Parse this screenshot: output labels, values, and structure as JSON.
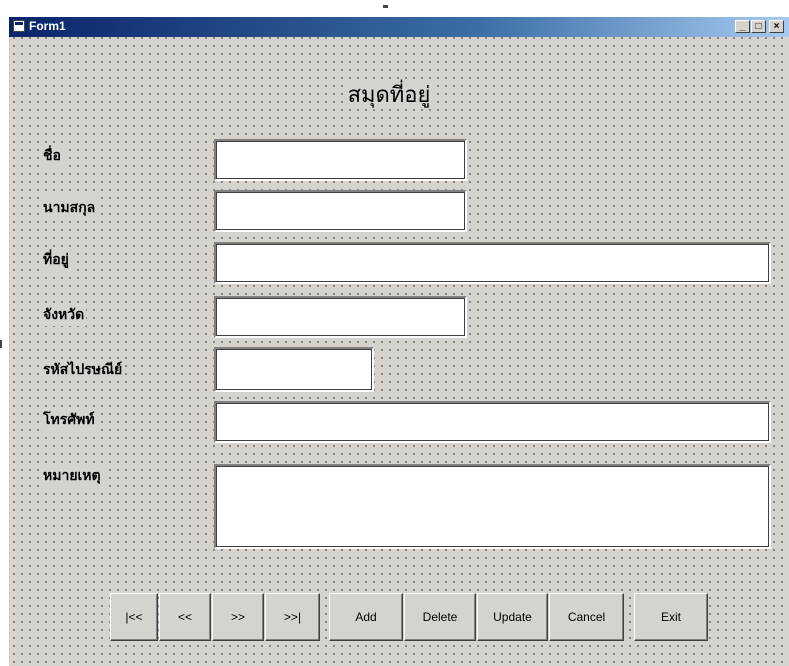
{
  "window": {
    "title": "Form1",
    "controls": {
      "minimize": "_",
      "maximize": "□",
      "close": "×"
    }
  },
  "form": {
    "heading": "สมุดที่อยู่",
    "fields": [
      {
        "label": "ชื่อ",
        "value": ""
      },
      {
        "label": "นามสกุล",
        "value": ""
      },
      {
        "label": "ที่อยู่",
        "value": ""
      },
      {
        "label": "จังหวัด",
        "value": ""
      },
      {
        "label": "รหัสไปรษณีย์",
        "value": ""
      },
      {
        "label": "โทรศัพท์",
        "value": ""
      },
      {
        "label": "หมายเหตุ",
        "value": ""
      }
    ]
  },
  "buttons": {
    "first": "|<<",
    "prev": "<<",
    "next": ">>",
    "last": ">>|",
    "add": "Add",
    "delete": "Delete",
    "update": "Update",
    "cancel": "Cancel",
    "exit": "Exit"
  },
  "colors": {
    "form_background": "#d6d3ce",
    "titlebar_start": "#0a246a",
    "titlebar_end": "#a6caf0"
  }
}
